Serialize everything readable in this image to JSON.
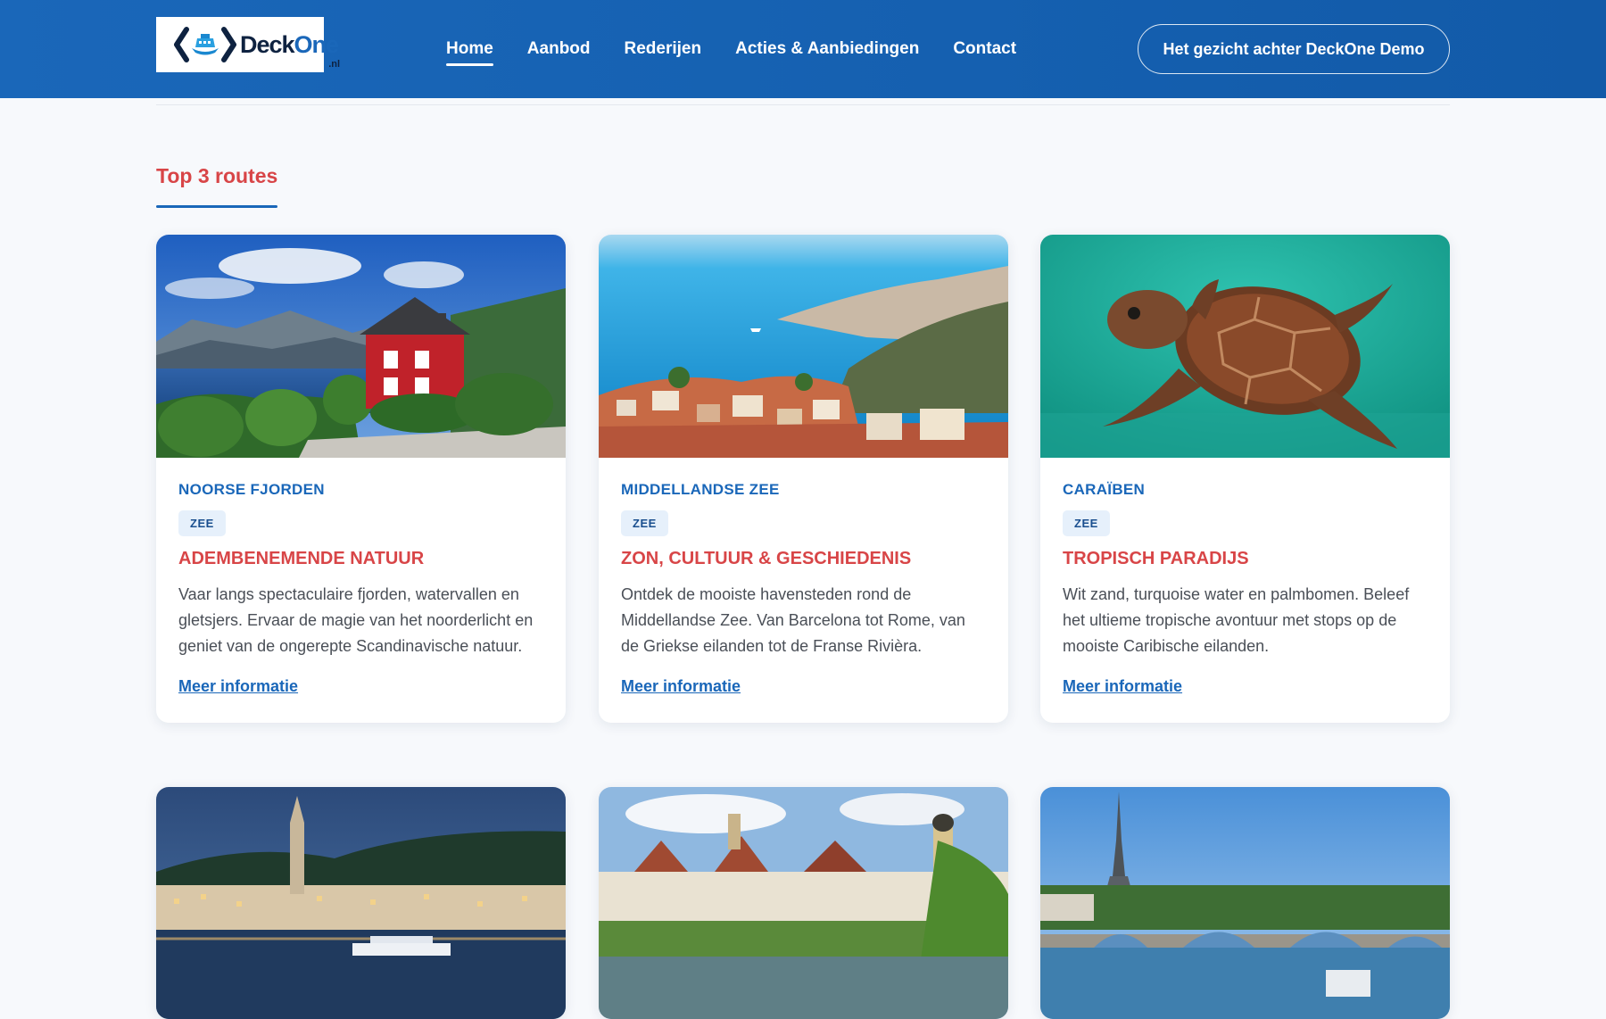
{
  "header": {
    "logo_text_a": "Deck",
    "logo_text_b": "One",
    "logo_tld": ".nl",
    "nav": [
      {
        "label": "Home",
        "active": true
      },
      {
        "label": "Aanbod"
      },
      {
        "label": "Rederijen"
      },
      {
        "label": "Acties & Aanbiedingen"
      },
      {
        "label": "Contact"
      }
    ],
    "cta_label": "Het gezicht achter DeckOne Demo"
  },
  "section": {
    "title": "Top 3 routes"
  },
  "cards": [
    {
      "region": "NOORSE FJORDEN",
      "badge": "ZEE",
      "title": "ADEMBENEMENDE NATUUR",
      "description": "Vaar langs spectaculaire fjorden, watervallen en gletsjers. Ervaar de magie van het noorderlicht en geniet van de ongerepte Scandinavische natuur.",
      "link": "Meer informatie"
    },
    {
      "region": "MIDDELLANDSE ZEE",
      "badge": "ZEE",
      "title": "ZON, CULTUUR & GESCHIEDENIS",
      "description": "Ontdek de mooiste havensteden rond de Middellandse Zee. Van Barcelona tot Rome, van de Griekse eilanden tot de Franse Rivièra.",
      "link": "Meer informatie"
    },
    {
      "region": "CARAÏBEN",
      "badge": "ZEE",
      "title": "TROPISCH PARADIJS",
      "description": "Wit zand, turquoise water en palmbomen. Beleef het ultieme tropische avontuur met stops op de mooiste Caribische eilanden.",
      "link": "Meer informatie"
    }
  ],
  "colors": {
    "brand_blue": "#1a67b9",
    "accent_red": "#d84547"
  }
}
